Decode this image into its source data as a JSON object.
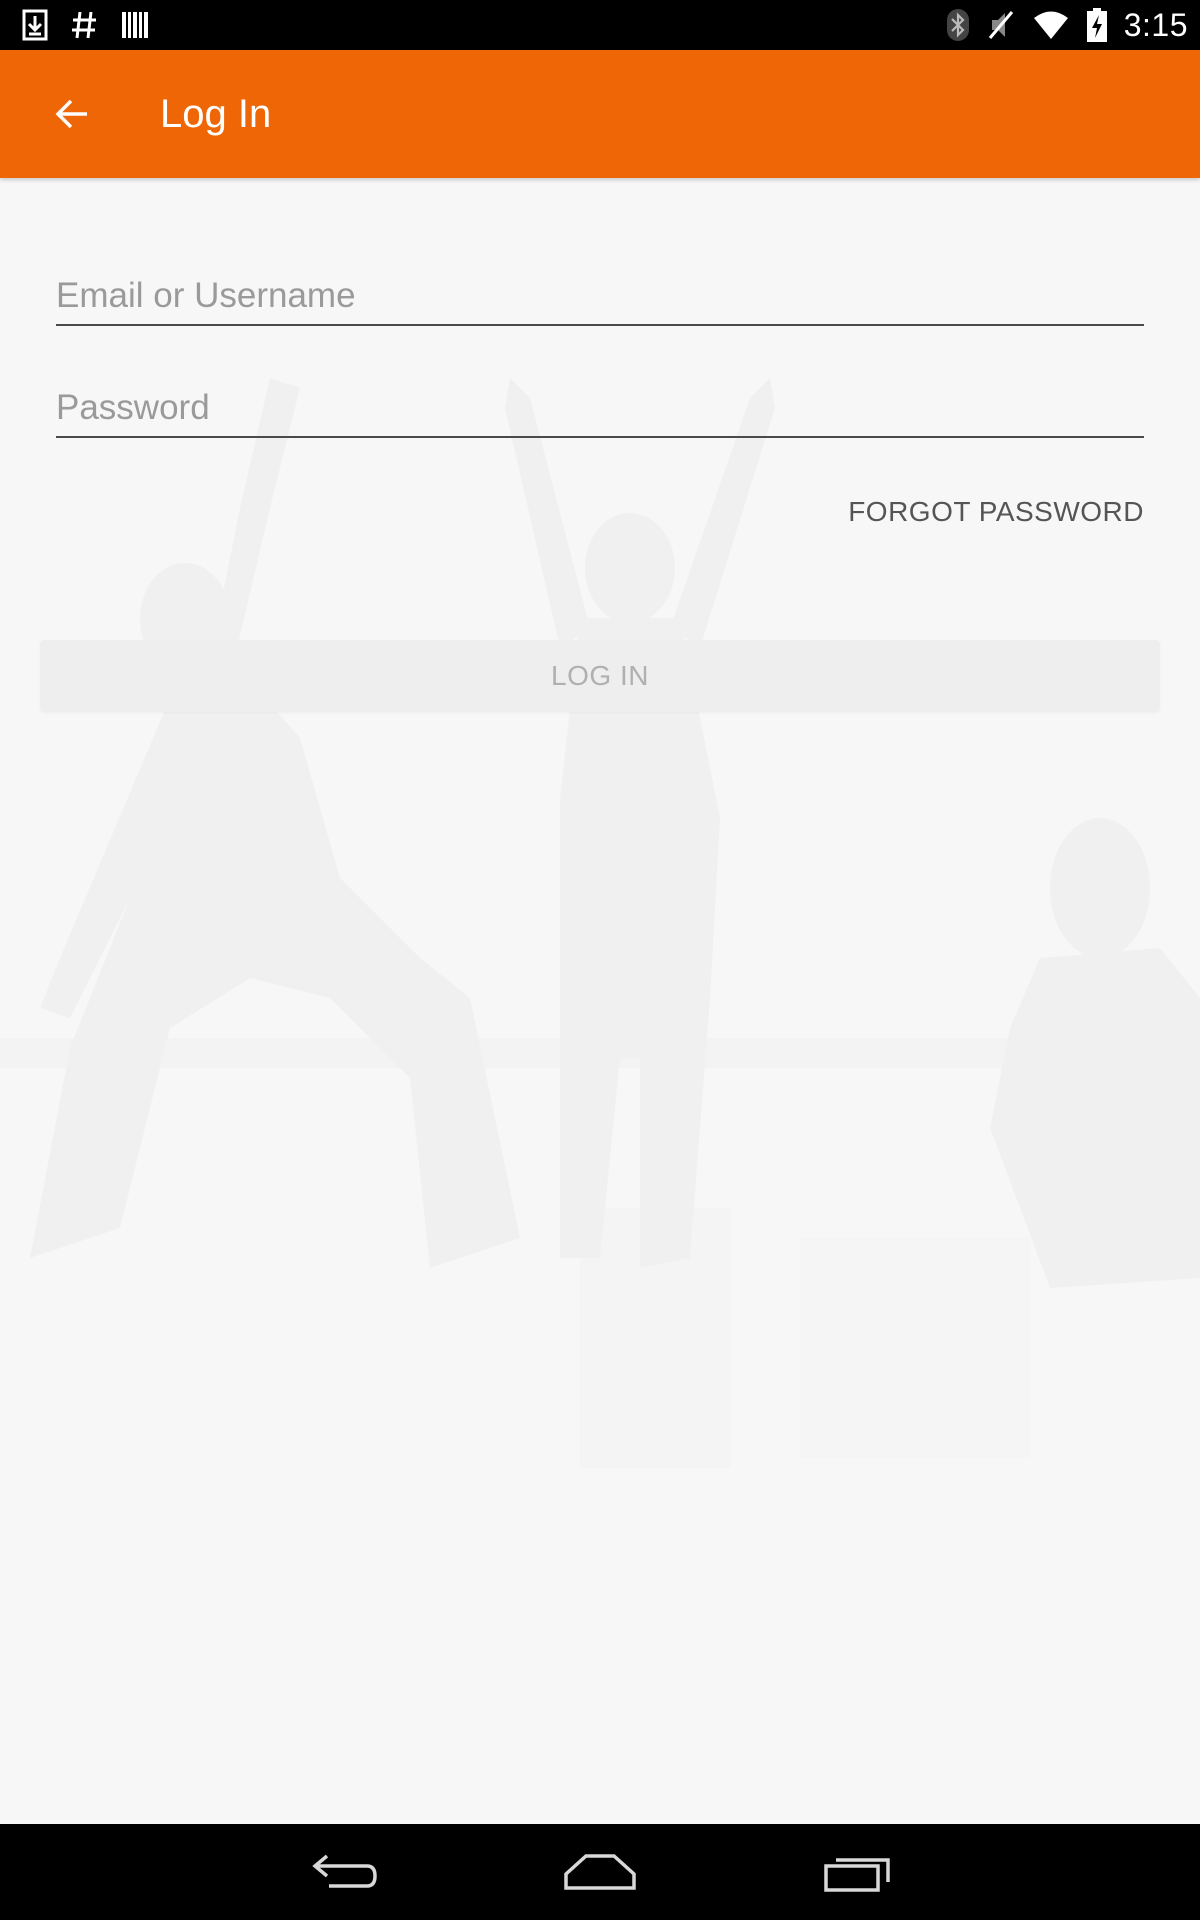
{
  "status_bar": {
    "time": "3:15",
    "left_icons": [
      "download-icon",
      "hash-icon",
      "barcode-icon"
    ],
    "right_icons": [
      "bluetooth-icon",
      "vibrate-mute-icon",
      "wifi-icon",
      "battery-charging-icon"
    ]
  },
  "app_bar": {
    "title": "Log In",
    "background": "#ef6606",
    "back_icon": "arrow-back-icon"
  },
  "form": {
    "email_placeholder": "Email or Username",
    "email_value": "",
    "password_placeholder": "Password",
    "password_value": "",
    "forgot_label": "FORGOT PASSWORD",
    "login_label": "LOG IN"
  },
  "nav_bar": {
    "buttons": [
      "back-icon",
      "home-icon",
      "recents-icon"
    ]
  }
}
